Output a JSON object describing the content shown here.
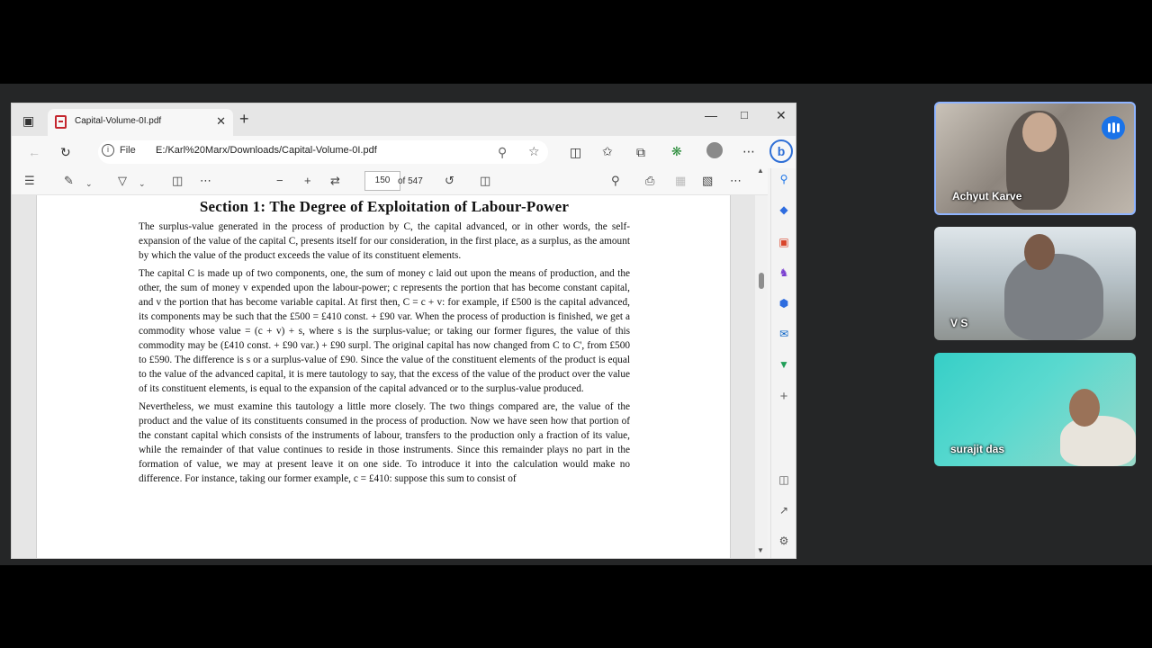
{
  "browser": {
    "tab_title": "Capital-Volume-0I.pdf",
    "file_label": "File",
    "url": "E:/Karl%20Marx/Downloads/Capital-Volume-0I.pdf"
  },
  "pdf_toolbar": {
    "current_page": "150",
    "page_total": "of 547"
  },
  "document": {
    "section_title": "Section 1: The Degree of Exploitation of Labour-Power",
    "paragraphs": [
      "The surplus-value generated in the process of production by C, the capital advanced, or in other words, the self-expansion of the value of the capital C, presents itself for our consideration, in the first place, as a surplus, as the amount by which the value of the product exceeds the value of its constituent elements.",
      "The capital C is made up of two components, one, the sum of money c laid out upon the means of production, and the other, the sum of money v expended upon the labour-power; c represents the portion that has become constant capital, and v the portion that has become variable capital. At first then, C = c + v: for example, if £500 is the capital advanced, its components may be such that the £500 = £410 const. + £90 var. When the process of production is finished, we get a commodity whose value = (c + v) + s, where s is the surplus-value; or taking our former figures, the value of this commodity may be (£410 const. + £90 var.) + £90 surpl. The original capital has now changed from C to C', from £500 to £590. The difference is s or a surplus-value of £90. Since the value of the constituent elements of the product is equal to the value of the advanced capital, it is mere tautology to say, that the excess of the value of the product over the value of its constituent elements, is equal to the expansion of the capital advanced or to the surplus-value produced.",
      "Nevertheless, we must examine this tautology a little more closely. The two things compared are, the value of the product and the value of its constituents consumed in the process of production. Now we have seen how that portion of the constant capital which consists of the instruments of labour, transfers to the production only a fraction of its value, while the remainder of that value continues to reside in those instruments. Since this remainder plays no part in the formation of value, we may at present leave it on one side. To introduce it into the calculation would make no difference. For instance, taking our former example, c = £410: suppose this sum to consist of"
    ]
  },
  "participants": [
    {
      "name": "Achyut Karve",
      "speaking": true
    },
    {
      "name": "V S"
    },
    {
      "name": "surajit das"
    }
  ]
}
